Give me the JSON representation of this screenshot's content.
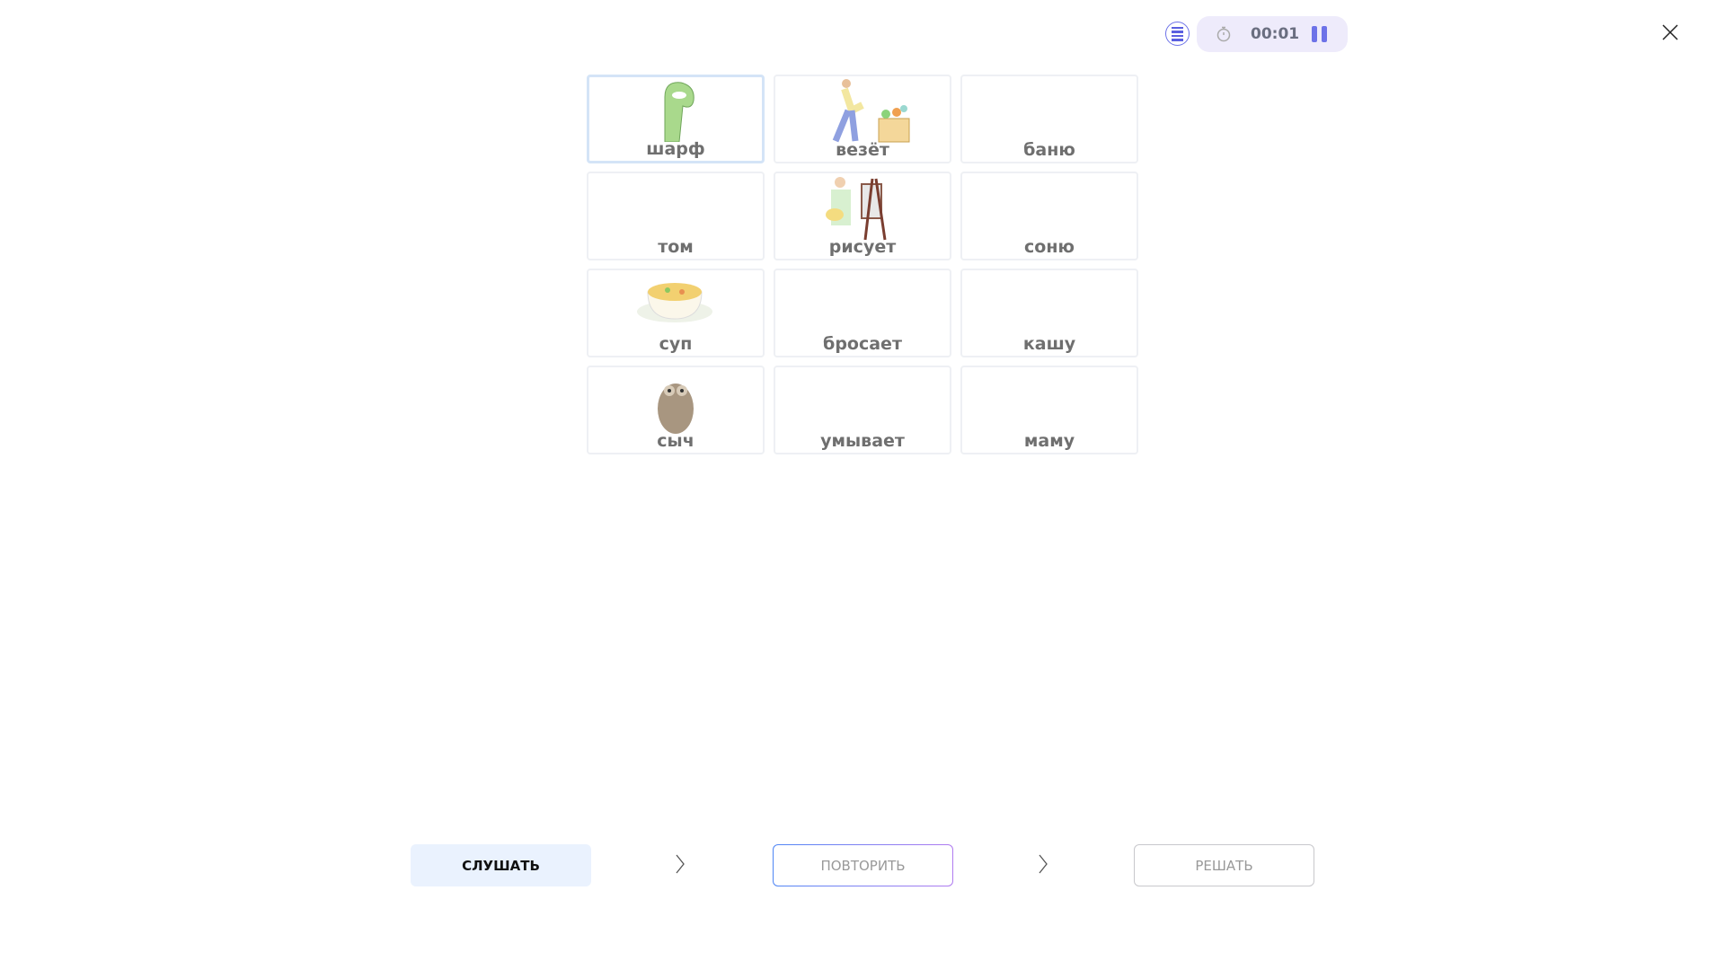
{
  "timer": {
    "time": "00:01"
  },
  "cards": [
    {
      "label": "шарф",
      "image": "scarf"
    },
    {
      "label": "везёт",
      "image": "man-pushing-cart"
    },
    {
      "label": "баню",
      "image": ""
    },
    {
      "label": "том",
      "image": ""
    },
    {
      "label": "рисует",
      "image": "painter-easel"
    },
    {
      "label": "соню",
      "image": ""
    },
    {
      "label": "суп",
      "image": "soup-bowl"
    },
    {
      "label": "бросает",
      "image": ""
    },
    {
      "label": "кашу",
      "image": ""
    },
    {
      "label": "сыч",
      "image": "owl"
    },
    {
      "label": "умывает",
      "image": ""
    },
    {
      "label": "маму",
      "image": ""
    }
  ],
  "steps": {
    "listen": "СЛУШАТЬ",
    "repeat": "ПОВТОРИТЬ",
    "solve": "РЕШАТЬ"
  },
  "colors": {
    "accent": "#6d72e8",
    "pill": "#eeebfb",
    "listen_bg": "#eaf2fe"
  }
}
